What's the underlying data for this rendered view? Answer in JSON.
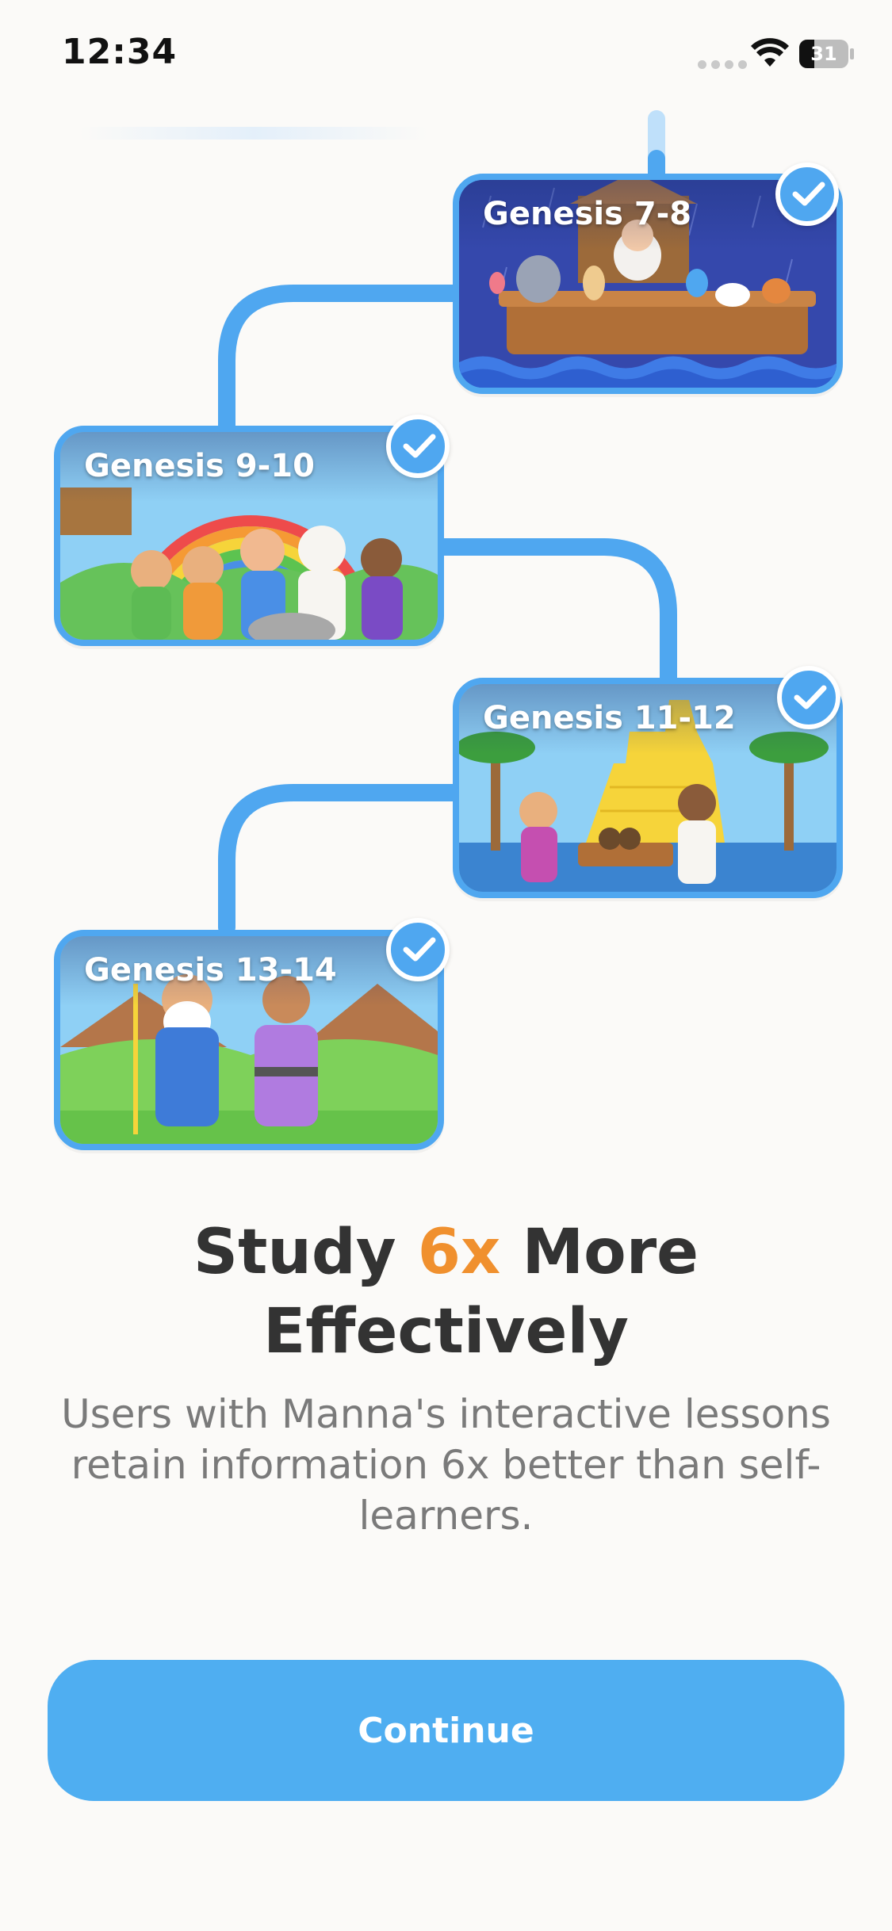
{
  "status_bar": {
    "time": "12:34",
    "battery": "31"
  },
  "lessons": [
    {
      "title": "Genesis 7-8",
      "completed": true
    },
    {
      "title": "Genesis 9-10",
      "completed": true
    },
    {
      "title": "Genesis 11-12",
      "completed": true
    },
    {
      "title": "Genesis 13-14",
      "completed": true
    }
  ],
  "headline": {
    "before": "Study ",
    "accent": "6x",
    "after": " More Effectively"
  },
  "subtext": "Users with Manna's interactive lessons retain information 6x better than self-learners.",
  "continue_label": "Continue",
  "colors": {
    "path": "#4FA7F0",
    "accent": "#F0902E",
    "button": "#4FAEF1",
    "background": "#FBFAF8"
  }
}
